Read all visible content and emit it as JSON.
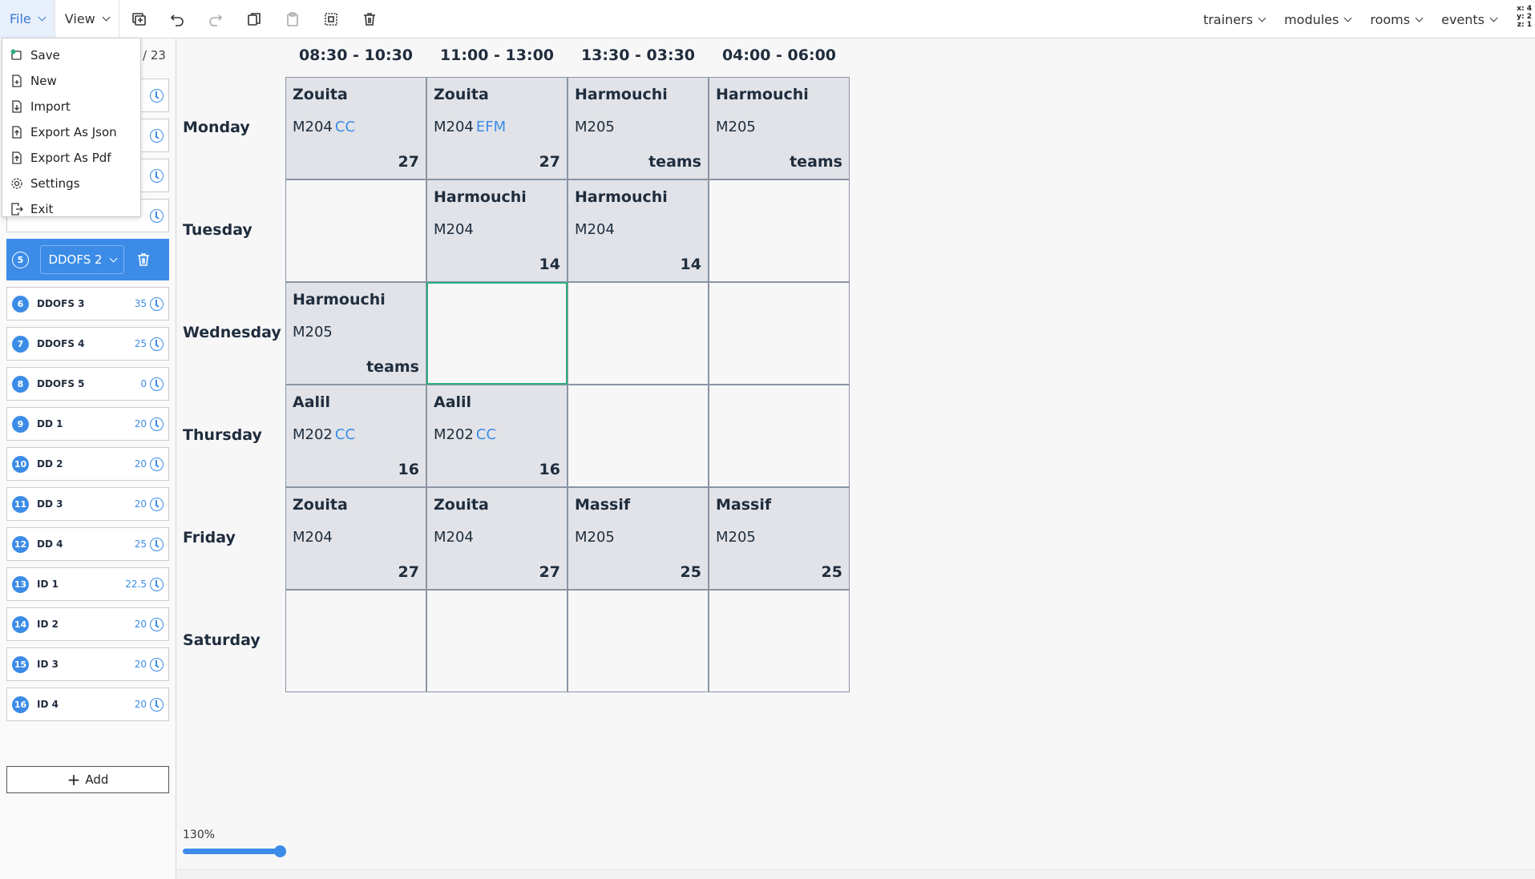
{
  "menu": {
    "file": "File",
    "view": "View"
  },
  "filters": [
    "trainers",
    "modules",
    "rooms",
    "events"
  ],
  "coords": {
    "x": "x: 4",
    "y": "y: 2",
    "z": "z: 1"
  },
  "file_menu": [
    "Save",
    "New",
    "Import",
    "Export As Json",
    "Export As Pdf",
    "Settings",
    "Exit"
  ],
  "sidebar": {
    "total": "/ 23",
    "selected": {
      "num": "5",
      "name": "DDOFS 2"
    },
    "groups": [
      {
        "num": "6",
        "name": "DDOFS 3",
        "hours": "35"
      },
      {
        "num": "7",
        "name": "DDOFS 4",
        "hours": "25"
      },
      {
        "num": "8",
        "name": "DDOFS 5",
        "hours": "0"
      },
      {
        "num": "9",
        "name": "DD 1",
        "hours": "20"
      },
      {
        "num": "10",
        "name": "DD 2",
        "hours": "20"
      },
      {
        "num": "11",
        "name": "DD 3",
        "hours": "20"
      },
      {
        "num": "12",
        "name": "DD 4",
        "hours": "25"
      },
      {
        "num": "13",
        "name": "ID 1",
        "hours": "22.5"
      },
      {
        "num": "14",
        "name": "ID 2",
        "hours": "20"
      },
      {
        "num": "15",
        "name": "ID 3",
        "hours": "20"
      },
      {
        "num": "16",
        "name": "ID 4",
        "hours": "20"
      }
    ],
    "add_label": "Add"
  },
  "timetable": {
    "slots": [
      "08:30 - 10:30",
      "11:00 - 13:00",
      "13:30 - 03:30",
      "04:00 - 06:00"
    ],
    "days": [
      "Monday",
      "Tuesday",
      "Wednesday",
      "Thursday",
      "Friday",
      "Saturday"
    ],
    "sessions": [
      {
        "day": 0,
        "slot": 0,
        "trainer": "Zouita",
        "module": "M204",
        "tag": "CC",
        "room": "27"
      },
      {
        "day": 0,
        "slot": 1,
        "trainer": "Zouita",
        "module": "M204",
        "tag": "EFM",
        "room": "27"
      },
      {
        "day": 0,
        "slot": 2,
        "trainer": "Harmouchi",
        "module": "M205",
        "tag": "",
        "room": "teams"
      },
      {
        "day": 0,
        "slot": 3,
        "trainer": "Harmouchi",
        "module": "M205",
        "tag": "",
        "room": "teams"
      },
      {
        "day": 1,
        "slot": 1,
        "trainer": "Harmouchi",
        "module": "M204",
        "tag": "",
        "room": "14"
      },
      {
        "day": 1,
        "slot": 2,
        "trainer": "Harmouchi",
        "module": "M204",
        "tag": "",
        "room": "14"
      },
      {
        "day": 2,
        "slot": 0,
        "trainer": "Harmouchi",
        "module": "M205",
        "tag": "",
        "room": "teams"
      },
      {
        "day": 3,
        "slot": 0,
        "trainer": "Aalil",
        "module": "M202",
        "tag": "CC",
        "room": "16"
      },
      {
        "day": 3,
        "slot": 1,
        "trainer": "Aalil",
        "module": "M202",
        "tag": "CC",
        "room": "16"
      },
      {
        "day": 4,
        "slot": 0,
        "trainer": "Zouita",
        "module": "M204",
        "tag": "",
        "room": "27"
      },
      {
        "day": 4,
        "slot": 1,
        "trainer": "Zouita",
        "module": "M204",
        "tag": "",
        "room": "27"
      },
      {
        "day": 4,
        "slot": 2,
        "trainer": "Massif",
        "module": "M205",
        "tag": "",
        "room": "25"
      },
      {
        "day": 4,
        "slot": 3,
        "trainer": "Massif",
        "module": "M205",
        "tag": "",
        "room": "25"
      }
    ],
    "active_cell": {
      "day": 2,
      "slot": 1
    }
  },
  "zoom": {
    "label": "130%",
    "value": 1.3
  },
  "colors": {
    "accent": "#3c8ce7",
    "active_border": "#2fae7e",
    "filled": "#e1e3e8"
  }
}
